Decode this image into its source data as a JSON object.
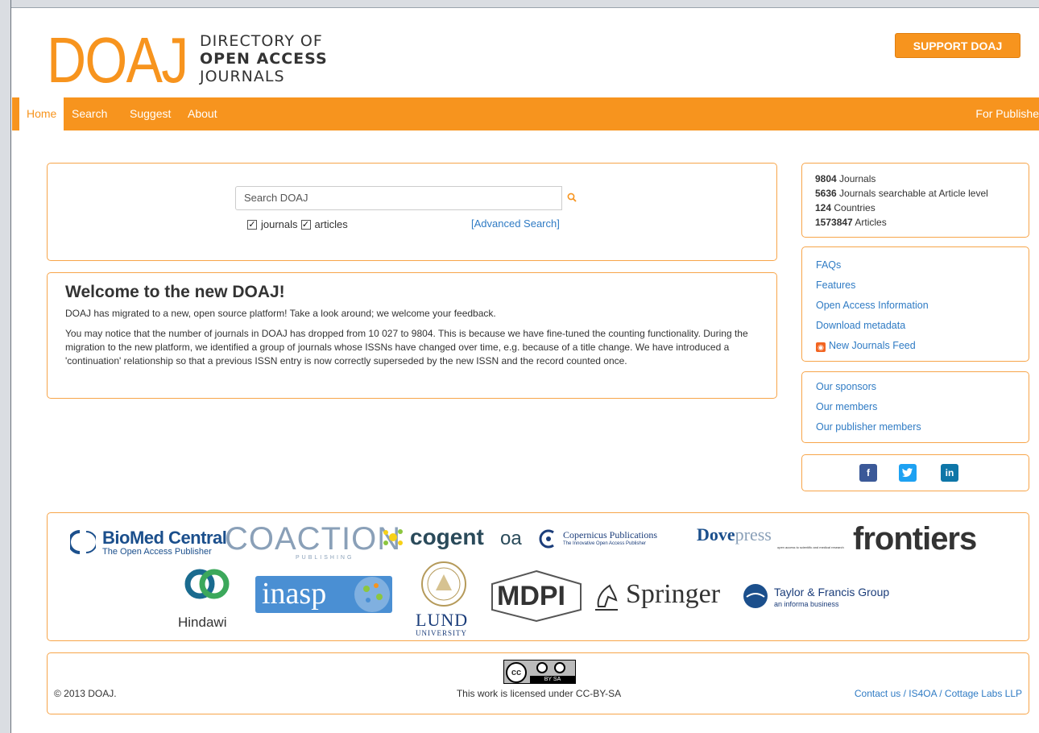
{
  "header": {
    "logo_big": "DOAJ",
    "logo_line1": "DIRECTORY OF",
    "logo_line2": "OPEN ACCESS",
    "logo_line3": "JOURNALS",
    "support_label": "SUPPORT DOAJ"
  },
  "nav": {
    "items": [
      "Home",
      "Search",
      "Suggest",
      "About"
    ],
    "right_item": "For Publishe"
  },
  "search": {
    "placeholder": "Search DOAJ",
    "journals_label": "journals",
    "articles_label": "articles",
    "journals_checked": true,
    "articles_checked": true,
    "advanced_label": "[Advanced Search]"
  },
  "welcome": {
    "title": "Welcome to the new DOAJ!",
    "para1": "DOAJ has migrated to a new, open source platform! Take a look around; we welcome your feedback.",
    "para2": "You may notice that the number of journals in DOAJ has dropped from 10 027 to 9804. This is because we have fine-tuned the counting functionality. During the migration to the new platform, we identified a group of journals whose ISSNs have changed over time, e.g. because of a title change. We have introduced a 'continuation' relationship so that a previous ISSN entry is now correctly superseded by the new ISSN and the record counted once."
  },
  "stats": [
    {
      "num": "9804",
      "label": " Journals"
    },
    {
      "num": "5636",
      "label": " Journals searchable at Article level"
    },
    {
      "num": "124",
      "label": " Countries"
    },
    {
      "num": "1573847",
      "label": " Articles"
    }
  ],
  "links": [
    "FAQs",
    "Features",
    "Open Access Information",
    "Download metadata",
    "New Journals Feed"
  ],
  "members": [
    "Our sponsors",
    "Our members",
    "Our publisher members"
  ],
  "social": {
    "facebook": "f",
    "twitter": "t",
    "linkedin": "in",
    "facebook_color": "#3b5998",
    "twitter_color": "#1da1f2",
    "linkedin_color": "#0e76a8"
  },
  "sponsors": {
    "biomed_main": "BioMed Central",
    "biomed_sub": "The Open Access Publisher",
    "coaction": "COACTION",
    "coaction_sub": "PUBLISHING",
    "cogent": "cogent",
    "cogent_oa": "oa",
    "copernicus": "Copernicus Publications",
    "copernicus_sub": "The Innovative Open Access Publisher",
    "dove": "Dove",
    "dove_press": "press",
    "dove_sub": "open access to scientific and medical research",
    "frontiers": "frontiers",
    "hindawi": "Hindawi",
    "inasp": "inasp",
    "lund_1": "LUND",
    "lund_2": "UNIVERSITY",
    "mdpi": "MDPI",
    "springer": "Springer",
    "tandf": "Taylor & Francis Group",
    "tandf_sub": "an informa business"
  },
  "footer": {
    "copyright": "© 2013 DOAJ.",
    "license": "This work is licensed under CC-BY-SA",
    "contact": "Contact us / IS4OA / Cottage Labs LLP",
    "cc_text": "cc",
    "by_sa": "BY SA"
  },
  "colors": {
    "brand": "#f7941e",
    "link": "#2f7bc4"
  }
}
